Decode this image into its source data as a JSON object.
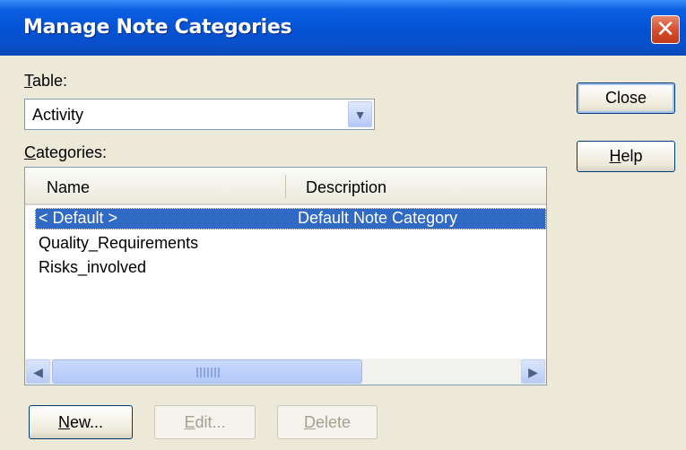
{
  "window": {
    "title": "Manage Note Categories",
    "close_glyph": "✕"
  },
  "table": {
    "label_u": "T",
    "label_rest": "able:",
    "selected": "Activity"
  },
  "categories": {
    "label_u": "C",
    "label_rest": "ategories:",
    "columns": [
      "Name",
      "Description"
    ],
    "rows": [
      {
        "name": "< Default >",
        "description": "Default Note Category",
        "selected": true
      },
      {
        "name": "Quality_Requirements",
        "description": "",
        "selected": false
      },
      {
        "name": "Risks_involved",
        "description": "",
        "selected": false
      }
    ]
  },
  "buttons": {
    "close": "Close",
    "help_u": "H",
    "help_rest": "elp",
    "new_u": "N",
    "new_rest": "ew...",
    "edit_u": "E",
    "edit_rest": "dit...",
    "delete_u": "D",
    "delete_rest": "elete"
  },
  "colors": {
    "titlebar": "#0452d4",
    "selection": "#316ac5",
    "dialog_bg": "#ece9d8"
  }
}
